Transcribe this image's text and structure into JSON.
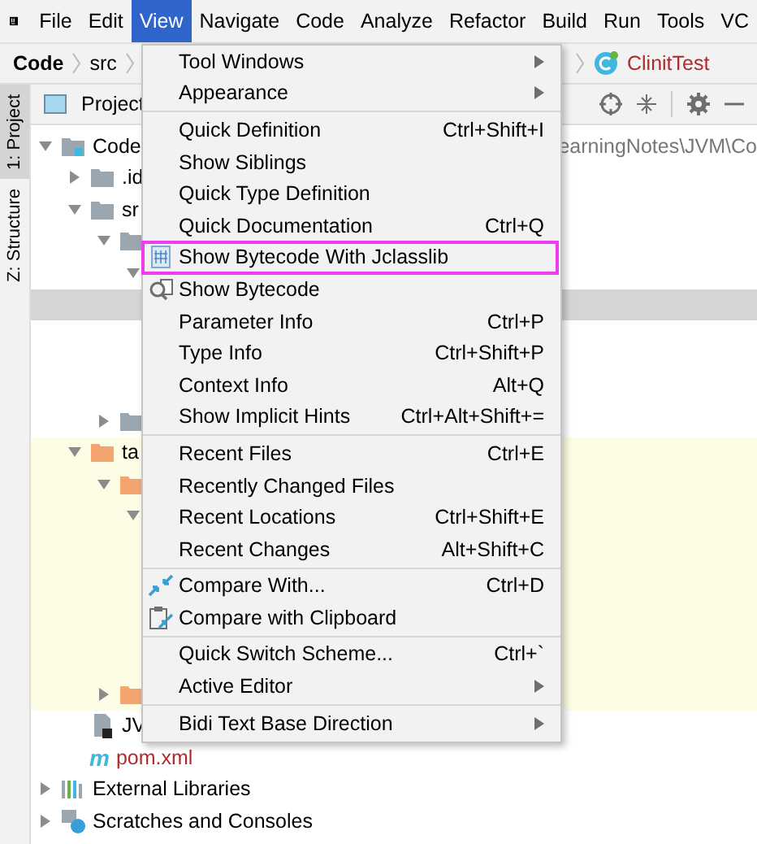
{
  "menubar": [
    {
      "label": "File",
      "selected": false
    },
    {
      "label": "Edit",
      "selected": false
    },
    {
      "label": "View",
      "selected": true
    },
    {
      "label": "Navigate",
      "selected": false
    },
    {
      "label": "Code",
      "selected": false
    },
    {
      "label": "Analyze",
      "selected": false
    },
    {
      "label": "Refactor",
      "selected": false
    },
    {
      "label": "Build",
      "selected": false
    },
    {
      "label": "Run",
      "selected": false
    },
    {
      "label": "Tools",
      "selected": false
    },
    {
      "label": "VC",
      "selected": false
    }
  ],
  "breadcrumbs": [
    {
      "label": "Code",
      "kind": "module"
    },
    {
      "label": "src",
      "kind": "folder"
    },
    {
      "label": "ClinitTest",
      "kind": "class"
    }
  ],
  "tool_strip": [
    {
      "label": "1: Project",
      "selected": true
    },
    {
      "label": "Z: Structure",
      "selected": false
    }
  ],
  "project_panel": {
    "title": "Project",
    "tree": [
      {
        "label": "Code",
        "kind": "module",
        "expanded": true,
        "selected": false,
        "path": "earningNotes\\JVM\\Co",
        "children": [
          {
            "label": ".id",
            "kind": "folder",
            "expanded": false,
            "selected": false
          },
          {
            "label": "sr",
            "kind": "folder",
            "expanded": true,
            "selected": false,
            "children": [
              {
                "kind": "folder",
                "expanded": true,
                "selected": false,
                "children": [
                  {
                    "expanded": true,
                    "selected": false,
                    "children": [
                      {
                        "selected": true
                      }
                    ]
                  }
                ]
              },
              {
                "kind": "folder",
                "expanded": false,
                "selected": false
              }
            ]
          },
          {
            "label": "ta",
            "kind": "excluded_folder",
            "expanded": true,
            "selected": false,
            "children": [
              {
                "kind": "excluded_folder",
                "expanded": true,
                "selected": false,
                "children": [
                  {
                    "expanded": true,
                    "selected": false
                  }
                ]
              },
              {
                "kind": "excluded_folder",
                "expanded": false,
                "selected": false
              }
            ]
          },
          {
            "label": "JV",
            "kind": "module_file",
            "selected": false
          },
          {
            "label": "pom.xml",
            "kind": "maven_file",
            "icon_glyph": "m",
            "selected": false
          }
        ]
      },
      {
        "label": "External Libraries",
        "kind": "libraries",
        "expanded": false,
        "selected": false
      },
      {
        "label": "Scratches and Consoles",
        "kind": "scratches",
        "expanded": false,
        "selected": false
      }
    ]
  },
  "menu": {
    "items": [
      {
        "kind": "submenu",
        "label": "Tool Windows"
      },
      {
        "kind": "submenu",
        "label": "Appearance"
      },
      {
        "kind": "separator"
      },
      {
        "kind": "item",
        "label": "Quick Definition",
        "shortcut": "Ctrl+Shift+I"
      },
      {
        "kind": "item",
        "label": "Show Siblings"
      },
      {
        "kind": "item",
        "label": "Quick Type Definition"
      },
      {
        "kind": "item",
        "label": "Quick Documentation",
        "shortcut": "Ctrl+Q"
      },
      {
        "kind": "item",
        "label": "Show Bytecode With Jclasslib",
        "highlighted": true
      },
      {
        "kind": "item",
        "label": "Show Bytecode"
      },
      {
        "kind": "item",
        "label": "Parameter Info",
        "shortcut": "Ctrl+P"
      },
      {
        "kind": "item",
        "label": "Type Info",
        "shortcut": "Ctrl+Shift+P"
      },
      {
        "kind": "item",
        "label": "Context Info",
        "shortcut": "Alt+Q"
      },
      {
        "kind": "item",
        "label": "Show Implicit Hints",
        "shortcut": "Ctrl+Alt+Shift+="
      },
      {
        "kind": "separator"
      },
      {
        "kind": "item",
        "label": "Recent Files",
        "shortcut": "Ctrl+E"
      },
      {
        "kind": "item",
        "label": "Recently Changed Files"
      },
      {
        "kind": "item",
        "label": "Recent Locations",
        "shortcut": "Ctrl+Shift+E"
      },
      {
        "kind": "item",
        "label": "Recent Changes",
        "shortcut": "Alt+Shift+C"
      },
      {
        "kind": "separator"
      },
      {
        "kind": "item",
        "label": "Compare With...",
        "shortcut": "Ctrl+D"
      },
      {
        "kind": "item",
        "label": "Compare with Clipboard"
      },
      {
        "kind": "separator"
      },
      {
        "kind": "item",
        "label": "Quick Switch Scheme...",
        "shortcut": "Ctrl+`"
      },
      {
        "kind": "submenu",
        "label": "Active Editor"
      },
      {
        "kind": "separator"
      },
      {
        "kind": "submenu",
        "label": "Bidi Text Base Direction"
      }
    ]
  }
}
